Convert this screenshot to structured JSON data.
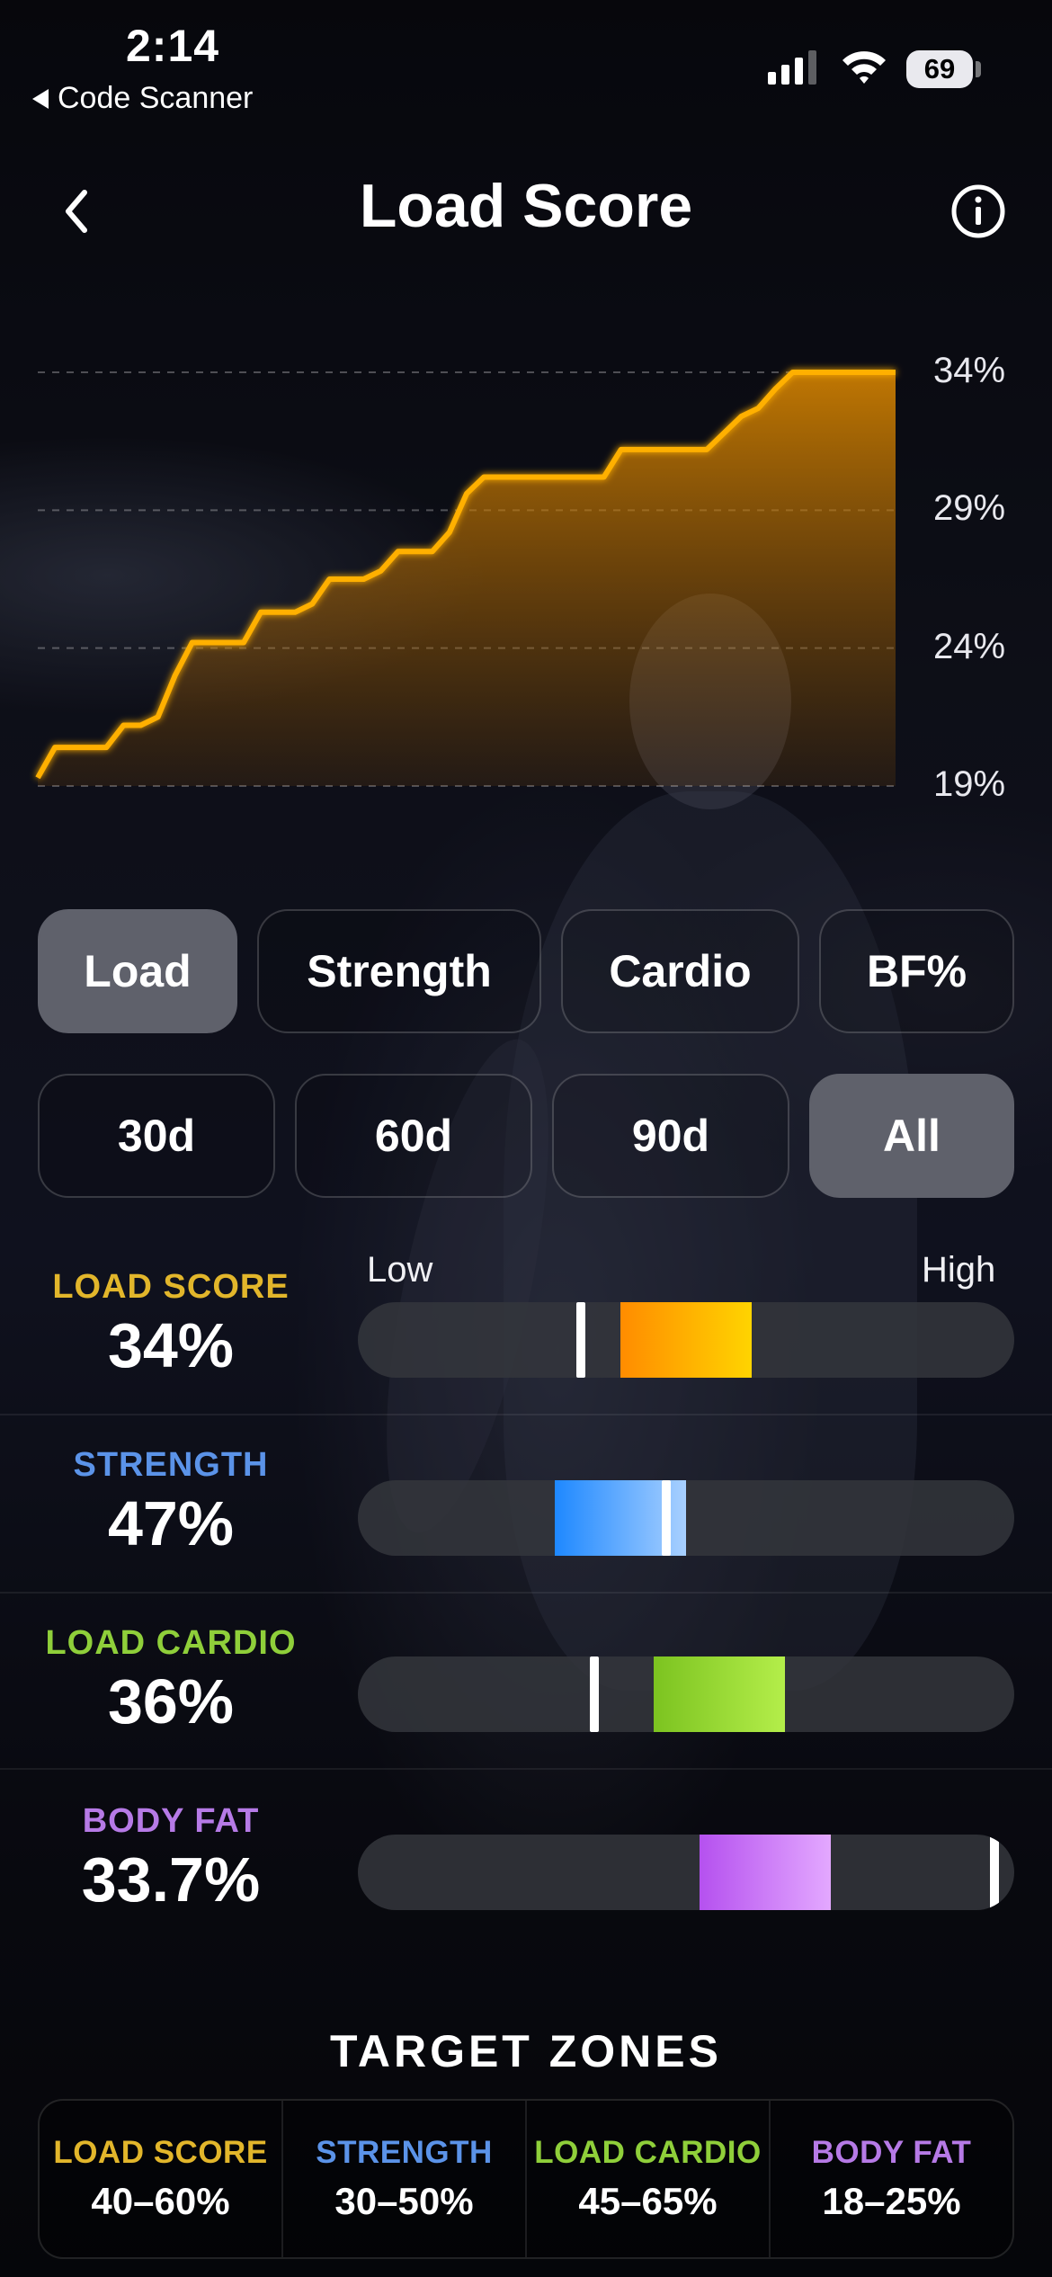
{
  "status": {
    "time": "2:14",
    "back_app": "Code Scanner",
    "battery": "69"
  },
  "nav": {
    "title": "Load Score"
  },
  "chart_data": {
    "type": "area",
    "y_ticks": [
      "34%",
      "29%",
      "24%",
      "19%"
    ],
    "ylim": [
      19,
      34
    ],
    "x": [
      0,
      1,
      2,
      3,
      4,
      5,
      6,
      7,
      8,
      9,
      10,
      11,
      12,
      13,
      14,
      15,
      16,
      17,
      18,
      19,
      20,
      21,
      22,
      23,
      24,
      25,
      26,
      27,
      28,
      29,
      30,
      31,
      32,
      33,
      34,
      35,
      36,
      37,
      38,
      39,
      40,
      41,
      42,
      43,
      44,
      45,
      46,
      47,
      48,
      49,
      50
    ],
    "values": [
      19.3,
      20.4,
      20.4,
      20.4,
      20.4,
      21.2,
      21.2,
      21.5,
      23.0,
      24.2,
      24.2,
      24.2,
      24.2,
      25.3,
      25.3,
      25.3,
      25.6,
      26.5,
      26.5,
      26.5,
      26.8,
      27.5,
      27.5,
      27.5,
      28.2,
      29.6,
      30.2,
      30.2,
      30.2,
      30.2,
      30.2,
      30.2,
      30.2,
      30.2,
      31.2,
      31.2,
      31.2,
      31.2,
      31.2,
      31.2,
      31.8,
      32.4,
      32.7,
      33.4,
      34.0,
      34.0,
      34.0,
      34.0,
      34.0,
      34.0,
      34.0
    ],
    "line_color": "#ffb000"
  },
  "metric_tabs": [
    {
      "label": "Load",
      "active": true
    },
    {
      "label": "Strength",
      "active": false
    },
    {
      "label": "Cardio",
      "active": false
    },
    {
      "label": "BF%",
      "active": false
    }
  ],
  "range_tabs": [
    {
      "label": "30d",
      "active": false
    },
    {
      "label": "60d",
      "active": false
    },
    {
      "label": "90d",
      "active": false
    },
    {
      "label": "All",
      "active": true
    }
  ],
  "scale": {
    "low": "Low",
    "high": "High"
  },
  "metrics": [
    {
      "label": "LOAD SCORE",
      "value": "34%",
      "color": "#e2b62b",
      "zone": [
        0.4,
        0.6
      ],
      "marker": 0.34,
      "gradient": [
        "#ff8c00",
        "#ffd400"
      ]
    },
    {
      "label": "STRENGTH",
      "value": "47%",
      "color": "#5b93e8",
      "zone": [
        0.3,
        0.5
      ],
      "marker": 0.47,
      "gradient": [
        "#1e88ff",
        "#a8d0ff"
      ]
    },
    {
      "label": "LOAD CARDIO",
      "value": "36%",
      "color": "#8fcf3a",
      "zone": [
        0.45,
        0.65
      ],
      "marker": 0.36,
      "gradient": [
        "#7cc320",
        "#b4ee4a"
      ]
    },
    {
      "label": "BODY FAT",
      "value": "33.7%",
      "color": "#b67ae6",
      "zone": [
        0.52,
        0.72
      ],
      "marker": 0.97,
      "gradient": [
        "#b551ef",
        "#e3a8ff"
      ]
    }
  ],
  "target_zones": {
    "title": "TARGET ZONES",
    "items": [
      {
        "label": "LOAD SCORE",
        "range": "40–60%",
        "color": "#e2b62b"
      },
      {
        "label": "STRENGTH",
        "range": "30–50%",
        "color": "#5b93e8"
      },
      {
        "label": "LOAD CARDIO",
        "range": "45–65%",
        "color": "#8fcf3a"
      },
      {
        "label": "BODY FAT",
        "range": "18–25%",
        "color": "#b67ae6"
      }
    ]
  },
  "icons": {
    "back": "chevron-left-icon",
    "info": "info-icon",
    "wifi": "wifi-icon",
    "signal": "cellular-signal-icon"
  }
}
